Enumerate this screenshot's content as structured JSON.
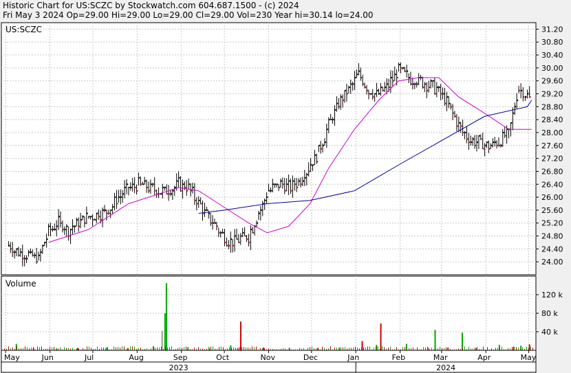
{
  "header": {
    "line1": "Historic Chart for US:SCZC by Stockwatch.com 604.687.1500 - (c) 2024",
    "line2": "Fri May  3 2024   Op=29.00   Hi=29.00   Lo=29.00   Cl=29.00   Vol=230   Year hi=30.14   lo=24.00"
  },
  "colors": {
    "up": "#000000",
    "down": "#cc0000",
    "ma_short": "#cc00cc",
    "ma_long": "#000099",
    "vol_up": "#00aa00",
    "vol_down": "#cc0000",
    "vol_flat": "#999999"
  },
  "chart_data": [
    {
      "type": "ohlc",
      "title": "US:SCZC",
      "ylim": [
        23.6,
        31.4
      ],
      "y_ticks": [
        "31.20",
        "30.80",
        "30.40",
        "30.00",
        "29.60",
        "29.20",
        "28.80",
        "28.40",
        "28.00",
        "27.60",
        "27.20",
        "26.80",
        "26.40",
        "26.00",
        "25.60",
        "25.20",
        "24.80",
        "24.40",
        "24.00"
      ],
      "x_months": [
        "May",
        "Jun",
        "Jul",
        "Aug",
        "Sep",
        "Oct",
        "Nov",
        "Dec",
        "Jan",
        "Feb",
        "Mar",
        "Apr",
        "May"
      ],
      "x_years": [
        "2023",
        "2024"
      ],
      "close_series": [
        [
          "2023-05-03",
          24.5
        ],
        [
          "2023-05-10",
          24.3
        ],
        [
          "2023-05-17",
          24.2
        ],
        [
          "2023-05-24",
          24.1
        ],
        [
          "2023-05-31",
          24.9
        ],
        [
          "2023-06-07",
          25.2
        ],
        [
          "2023-06-14",
          25.0
        ],
        [
          "2023-06-21",
          25.2
        ],
        [
          "2023-06-28",
          25.4
        ],
        [
          "2023-07-05",
          25.5
        ],
        [
          "2023-07-12",
          25.6
        ],
        [
          "2023-07-19",
          26.0
        ],
        [
          "2023-07-26",
          26.3
        ],
        [
          "2023-08-02",
          26.4
        ],
        [
          "2023-08-09",
          26.3
        ],
        [
          "2023-08-16",
          26.2
        ],
        [
          "2023-08-23",
          26.2
        ],
        [
          "2023-08-30",
          26.4
        ],
        [
          "2023-09-06",
          26.3
        ],
        [
          "2023-09-13",
          25.8
        ],
        [
          "2023-09-20",
          25.4
        ],
        [
          "2023-09-27",
          25.0
        ],
        [
          "2023-10-04",
          24.6
        ],
        [
          "2023-10-11",
          24.7
        ],
        [
          "2023-10-18",
          24.8
        ],
        [
          "2023-10-25",
          25.5
        ],
        [
          "2023-11-01",
          26.2
        ],
        [
          "2023-11-08",
          26.4
        ],
        [
          "2023-11-15",
          26.3
        ],
        [
          "2023-11-22",
          26.5
        ],
        [
          "2023-11-29",
          26.9
        ],
        [
          "2023-12-06",
          27.4
        ],
        [
          "2023-12-13",
          28.2
        ],
        [
          "2023-12-20",
          28.9
        ],
        [
          "2023-12-27",
          29.3
        ],
        [
          "2024-01-03",
          29.8
        ],
        [
          "2024-01-10",
          29.3
        ],
        [
          "2024-01-17",
          29.2
        ],
        [
          "2024-01-24",
          29.5
        ],
        [
          "2024-01-31",
          29.9
        ],
        [
          "2024-02-07",
          29.7
        ],
        [
          "2024-02-14",
          29.6
        ],
        [
          "2024-02-21",
          29.5
        ],
        [
          "2024-02-28",
          29.3
        ],
        [
          "2024-03-06",
          28.8
        ],
        [
          "2024-03-13",
          28.2
        ],
        [
          "2024-03-20",
          27.8
        ],
        [
          "2024-03-27",
          27.7
        ],
        [
          "2024-04-03",
          27.6
        ],
        [
          "2024-04-10",
          27.7
        ],
        [
          "2024-04-17",
          28.0
        ],
        [
          "2024-04-24",
          29.4
        ],
        [
          "2024-05-03",
          29.0
        ]
      ],
      "ma_short": [
        [
          "2023-05-31",
          24.6
        ],
        [
          "2023-06-28",
          25.0
        ],
        [
          "2023-07-26",
          25.8
        ],
        [
          "2023-08-30",
          26.3
        ],
        [
          "2023-09-13",
          26.2
        ],
        [
          "2023-09-27",
          25.8
        ],
        [
          "2023-10-18",
          25.2
        ],
        [
          "2023-10-31",
          24.9
        ],
        [
          "2023-11-15",
          25.1
        ],
        [
          "2023-11-30",
          25.8
        ],
        [
          "2023-12-13",
          26.9
        ],
        [
          "2023-12-31",
          28.1
        ],
        [
          "2024-01-17",
          29.0
        ],
        [
          "2024-01-31",
          29.6
        ],
        [
          "2024-02-14",
          29.7
        ],
        [
          "2024-02-28",
          29.7
        ],
        [
          "2024-03-13",
          29.1
        ],
        [
          "2024-03-31",
          28.6
        ],
        [
          "2024-04-17",
          28.1
        ],
        [
          "2024-05-03",
          28.1
        ]
      ],
      "ma_long": [
        [
          "2023-09-13",
          25.5
        ],
        [
          "2023-10-01",
          25.6
        ],
        [
          "2023-10-31",
          25.8
        ],
        [
          "2023-11-30",
          25.9
        ],
        [
          "2023-12-31",
          26.2
        ],
        [
          "2024-01-31",
          27.0
        ],
        [
          "2024-02-28",
          27.7
        ],
        [
          "2024-03-31",
          28.5
        ],
        [
          "2024-04-30",
          28.8
        ],
        [
          "2024-05-03",
          29.0
        ]
      ]
    },
    {
      "type": "bar",
      "title": "Volume",
      "ylim": [
        0,
        160
      ],
      "y_ticks": [
        "120 k",
        "80 k",
        "40 k"
      ],
      "bars_k": [
        [
          "2023-05-08",
          14
        ],
        [
          "2023-05-20",
          5
        ],
        [
          "2023-06-05",
          4
        ],
        [
          "2023-06-20",
          5
        ],
        [
          "2023-07-10",
          6
        ],
        [
          "2023-07-25",
          5
        ],
        [
          "2023-08-12",
          8
        ],
        [
          "2023-08-18",
          42
        ],
        [
          "2023-08-20",
          80
        ],
        [
          "2023-08-21",
          145
        ],
        [
          "2023-09-05",
          6
        ],
        [
          "2023-09-20",
          4
        ],
        [
          "2023-10-05",
          11
        ],
        [
          "2023-10-10",
          5
        ],
        [
          "2023-10-12",
          62
        ],
        [
          "2023-10-28",
          6
        ],
        [
          "2023-11-15",
          4
        ],
        [
          "2023-12-05",
          5
        ],
        [
          "2023-12-20",
          6
        ],
        [
          "2024-01-05",
          20
        ],
        [
          "2024-01-15",
          12
        ],
        [
          "2024-01-18",
          58
        ],
        [
          "2024-02-05",
          14
        ],
        [
          "2024-02-20",
          6
        ],
        [
          "2024-02-25",
          44
        ],
        [
          "2024-03-05",
          6
        ],
        [
          "2024-03-15",
          38
        ],
        [
          "2024-03-25",
          5
        ],
        [
          "2024-04-10",
          12
        ],
        [
          "2024-04-20",
          8
        ],
        [
          "2024-04-25",
          10
        ],
        [
          "2024-05-01",
          13
        ]
      ]
    }
  ]
}
